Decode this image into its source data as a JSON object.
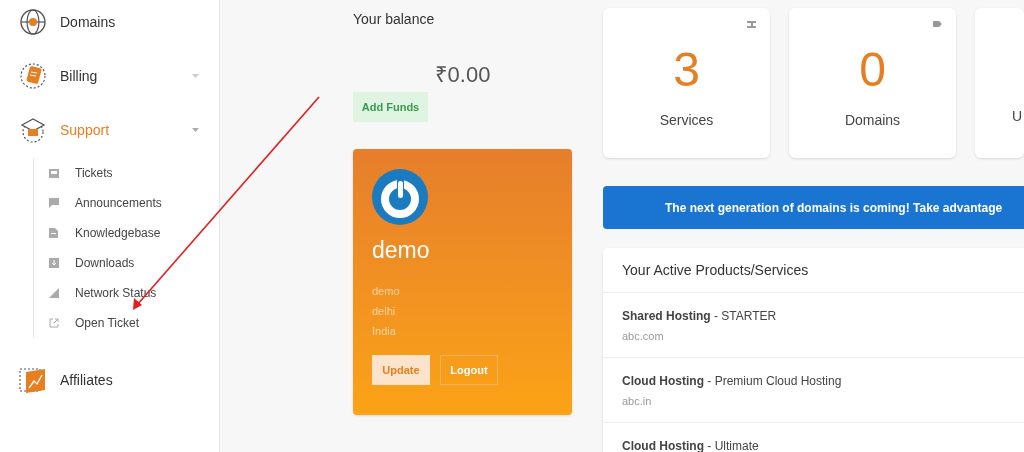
{
  "sidebar": {
    "items": [
      {
        "label": "Domains",
        "kind": "link",
        "selected": false
      },
      {
        "label": "Billing",
        "kind": "menu",
        "selected": false,
        "expanded": false
      },
      {
        "label": "Support",
        "kind": "menu",
        "selected": true,
        "expanded": true,
        "children": [
          {
            "label": "Tickets"
          },
          {
            "label": "Announcements"
          },
          {
            "label": "Knowledgebase"
          },
          {
            "label": "Downloads"
          },
          {
            "label": "Network Status"
          },
          {
            "label": "Open Ticket"
          }
        ]
      },
      {
        "label": "Affiliates",
        "kind": "link",
        "selected": false
      }
    ]
  },
  "balance": {
    "title": "Your balance",
    "amount": "₹0.00",
    "button": "Add Funds"
  },
  "profile": {
    "name": "demo",
    "lines": [
      "demo",
      "delhi",
      "India"
    ],
    "buttons": [
      "Update",
      "Logout"
    ]
  },
  "stats": [
    {
      "value": "3",
      "label": "Services"
    },
    {
      "value": "0",
      "label": "Domains"
    },
    {
      "label": "U"
    }
  ],
  "banner": "The next generation of domains is coming! Take advantage",
  "products": {
    "title": "Your Active Products/Services",
    "rows": [
      {
        "product": "**Shared Hosting** - STARTER",
        "domain": "abc.com"
      },
      {
        "product": "**Cloud Hosting** - Premium Cloud Hosting",
        "domain": "abc.in"
      },
      {
        "product": "**Cloud Hosting** - Ultimate"
      }
    ]
  }
}
